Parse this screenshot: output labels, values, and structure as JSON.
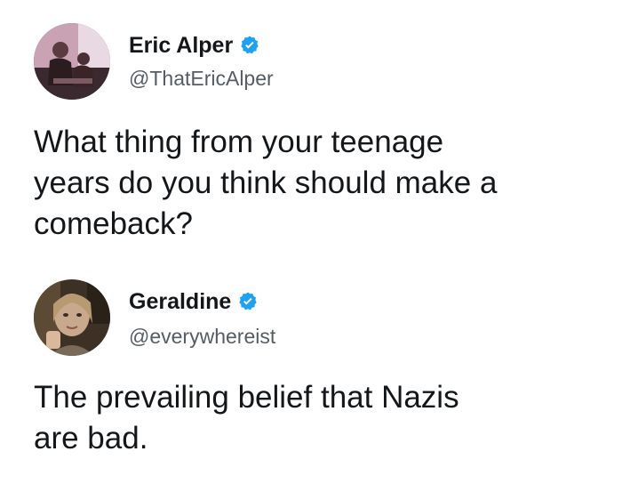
{
  "tweets": [
    {
      "author": {
        "display_name": "Eric Alper",
        "handle": "@ThatEricAlper",
        "verified": true,
        "avatar_icon": "profile-photo-eric"
      },
      "text_lines": [
        "What thing from your teenage",
        "years do you think should make a",
        "comeback?"
      ]
    },
    {
      "author": {
        "display_name": "Geraldine",
        "handle": "@everywhereist",
        "verified": true,
        "avatar_icon": "profile-photo-geraldine"
      },
      "text_lines": [
        "The prevailing belief that Nazis",
        "are bad."
      ]
    }
  ],
  "colors": {
    "verified_badge": "#1da1f2",
    "text_primary": "#14171a",
    "text_secondary": "#555d64",
    "background": "#ffffff"
  }
}
